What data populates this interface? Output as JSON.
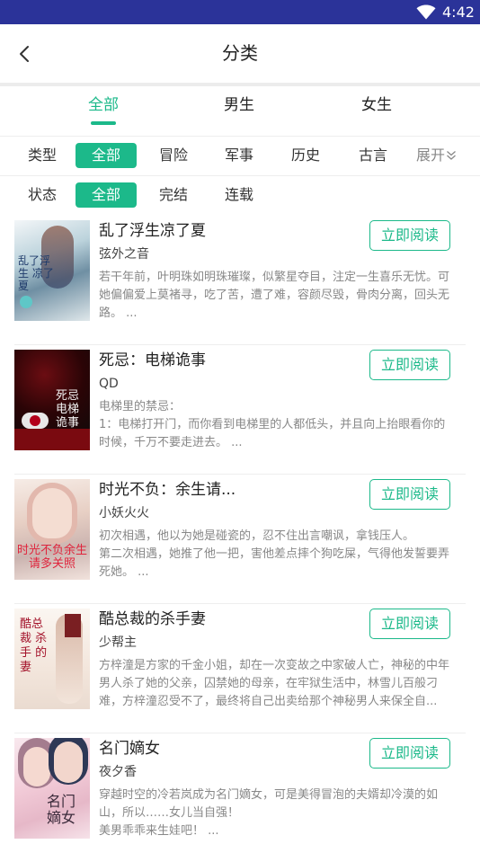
{
  "status_bar": {
    "time": "4:42",
    "icon": "wifi-icon"
  },
  "nav": {
    "title": "分类",
    "back_icon": "back-arrow-icon"
  },
  "tabs": [
    {
      "label": "全部",
      "active": true
    },
    {
      "label": "男生",
      "active": false
    },
    {
      "label": "女生",
      "active": false
    }
  ],
  "filters": {
    "type_label": "类型",
    "type_options": [
      "全部",
      "冒险",
      "军事",
      "历史",
      "古言"
    ],
    "expand_label": "展开",
    "status_label": "状态",
    "status_options": [
      "全部",
      "完结",
      "连载"
    ]
  },
  "read_label": "立即阅读",
  "books": [
    {
      "title": "乱了浮生凉了夏",
      "author": "弦外之音",
      "description": "若干年前，叶明珠如明珠璀璨，似繁星夺目，注定一生喜乐无忧。可她偏偏爱上莫褚寻，吃了苦，遭了难，容颜尽毁，骨肉分离，回头无路。 ...",
      "cover_text": "乱了浮生 凉了夏"
    },
    {
      "title": " 死忌：电梯诡事",
      "author": "QD",
      "description": "        电梯里的禁忌：\n1：电梯打开门，而你看到电梯里的人都低头，并且向上抬眼看你的时候，千万不要走进去。 ...",
      "cover_text": "死忌 电梯诡事"
    },
    {
      "title": "时光不负：余生请...",
      "author": "小妖火火",
      "description": "初次相遇，他以为她是碰瓷的，忍不住出言嘲讽，拿钱压人。\n第二次相遇，她推了他一把，害他差点摔个狗吃屎，气得他发誓要弄死她。 ...",
      "cover_text": "时光不负余生 请多关照"
    },
    {
      "title": "酷总裁的杀手妻",
      "author": "少帮主",
      "description": "方梓潼是方家的千金小姐，却在一次变故之中家破人亡，神秘的中年男人杀了她的父亲，囚禁她的母亲，在牢狱生活中，林雪儿百般刁难，方梓潼忍受不了，最终将自己出卖给那个神秘男人来保全自...",
      "cover_text": "酷总裁 杀手 的妻"
    },
    {
      "title": "名门嫡女",
      "author": "夜夕香",
      "description": "穿越时空的冷若岚成为名门嫡女，可是美得冒泡的夫婿却冷漠的如山，所以……女儿当自强！\n美男乖乖来生娃吧！ ...",
      "cover_text": "名门 嫡女"
    }
  ],
  "colors": {
    "accent": "#1cb98a",
    "status_bar": "#2b3399"
  }
}
